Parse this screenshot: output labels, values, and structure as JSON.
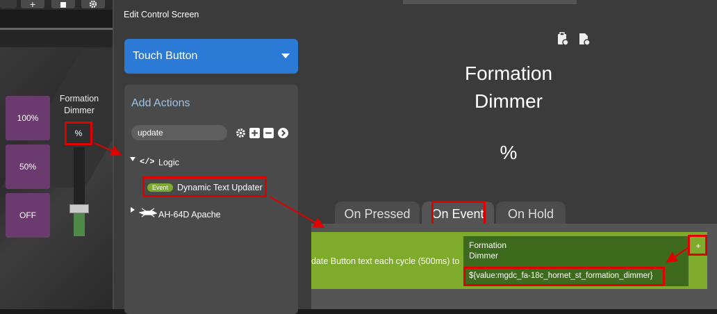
{
  "toolbar": {
    "add_label": "+",
    "delete_icon": "trash-icon",
    "settings_icon": "gear-icon"
  },
  "panel_preview": {
    "buttons": [
      "100%",
      "50%",
      "OFF"
    ],
    "label_line1": "Formation",
    "label_line2": "Dimmer",
    "value_text": "%",
    "slider_level": 0.26
  },
  "dialog": {
    "title": "Edit Control Screen",
    "type_select": "Touch Button",
    "add_actions_label": "Add Actions",
    "search_value": "update",
    "tree": {
      "logic_label": "Logic",
      "logic_icon_text": "</>",
      "event_badge": "Event",
      "dynamic_label": "Dynamic Text Updater",
      "apache_label": "AH-64D Apache"
    },
    "preview": {
      "line1": "Formation",
      "line2": "Dimmer",
      "value": "%"
    },
    "tabs": [
      "On Pressed",
      "On Event",
      "On Hold"
    ],
    "active_tab": "On Event",
    "event": {
      "description": "date Button text each cycle (500ms) to",
      "text_line1": "Formation",
      "text_line2": "Dimmer",
      "variable": "${value:mgdc_fa-18c_hornet_st_formation_dimmer}",
      "plus_label": "+"
    }
  },
  "colors": {
    "accent_blue": "#2b7bd6",
    "button_purple": "#6b3a6f",
    "event_green": "#7fab2c",
    "highlight_red": "#e00000"
  }
}
